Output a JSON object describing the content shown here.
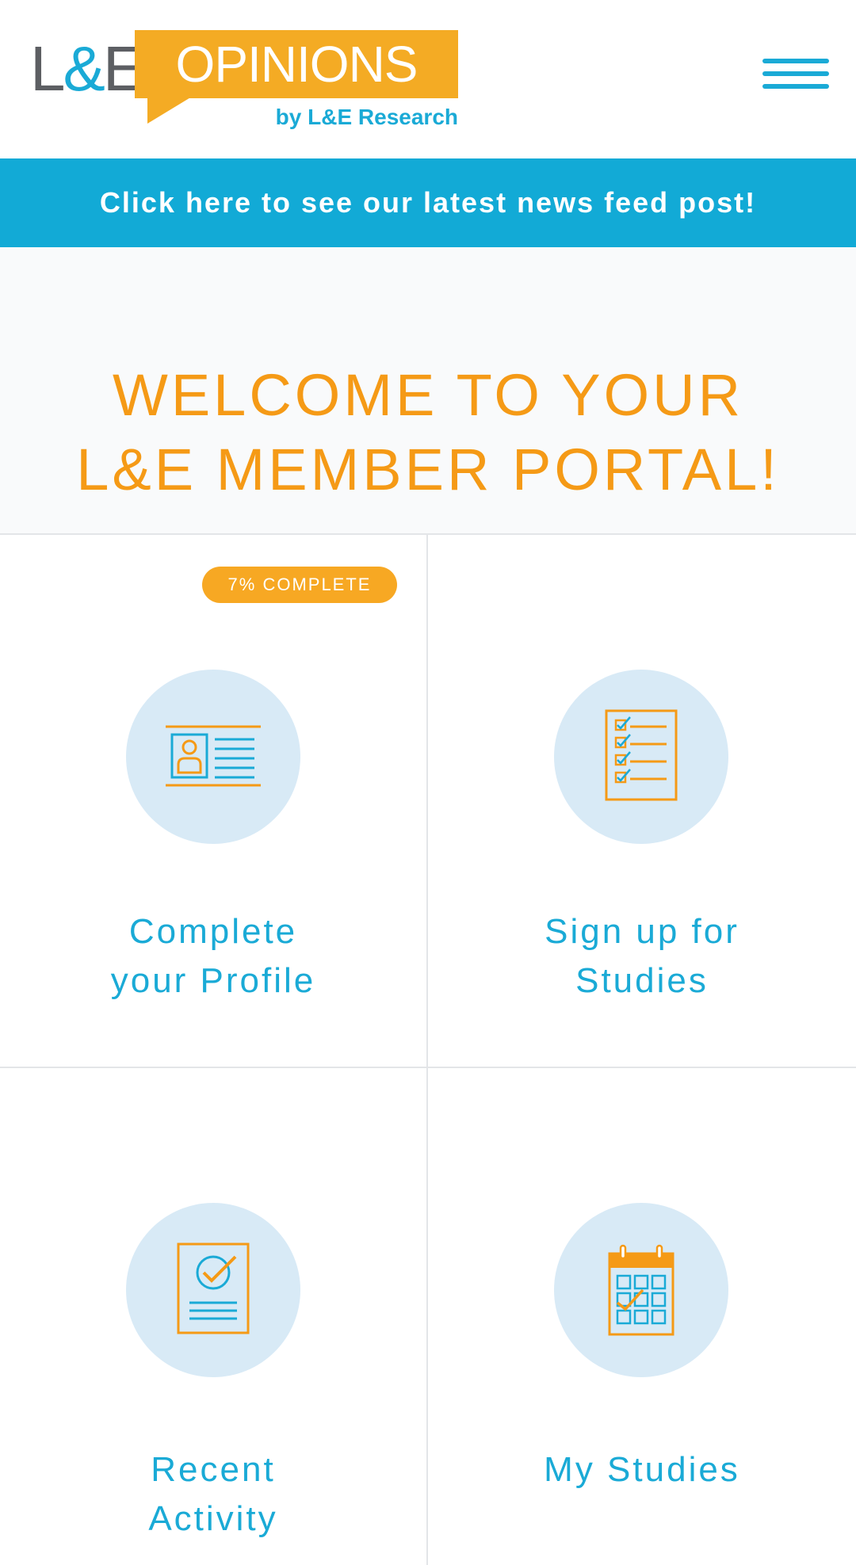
{
  "header": {
    "logo_le_left": "L",
    "logo_le_amp": "&",
    "logo_le_right": "E",
    "logo_brand": "OPINIONS",
    "logo_byline": "by L&E Research",
    "menu_icon": "hamburger-menu-icon"
  },
  "banner": {
    "text": "Click here to see our latest news feed post!"
  },
  "welcome": {
    "line1": "WELCOME TO YOUR",
    "line2": "L&E MEMBER PORTAL!"
  },
  "tiles": [
    {
      "line1": "Complete",
      "line2": "your Profile",
      "icon": "id-card-icon",
      "badge": "7% COMPLETE",
      "progress_percent": 7
    },
    {
      "line1": "Sign up for",
      "line2": "Studies",
      "icon": "checklist-icon"
    },
    {
      "line1": "Recent",
      "line2": "Activity",
      "icon": "approved-document-icon"
    },
    {
      "line1": "My Studies",
      "line2": "",
      "icon": "calendar-check-icon"
    }
  ],
  "colors": {
    "brand_blue": "#1aaad6",
    "brand_orange": "#f59a16",
    "logo_orange": "#f4ab24",
    "icon_circle": "#d8eaf6",
    "logo_grey": "#5d5f63"
  }
}
